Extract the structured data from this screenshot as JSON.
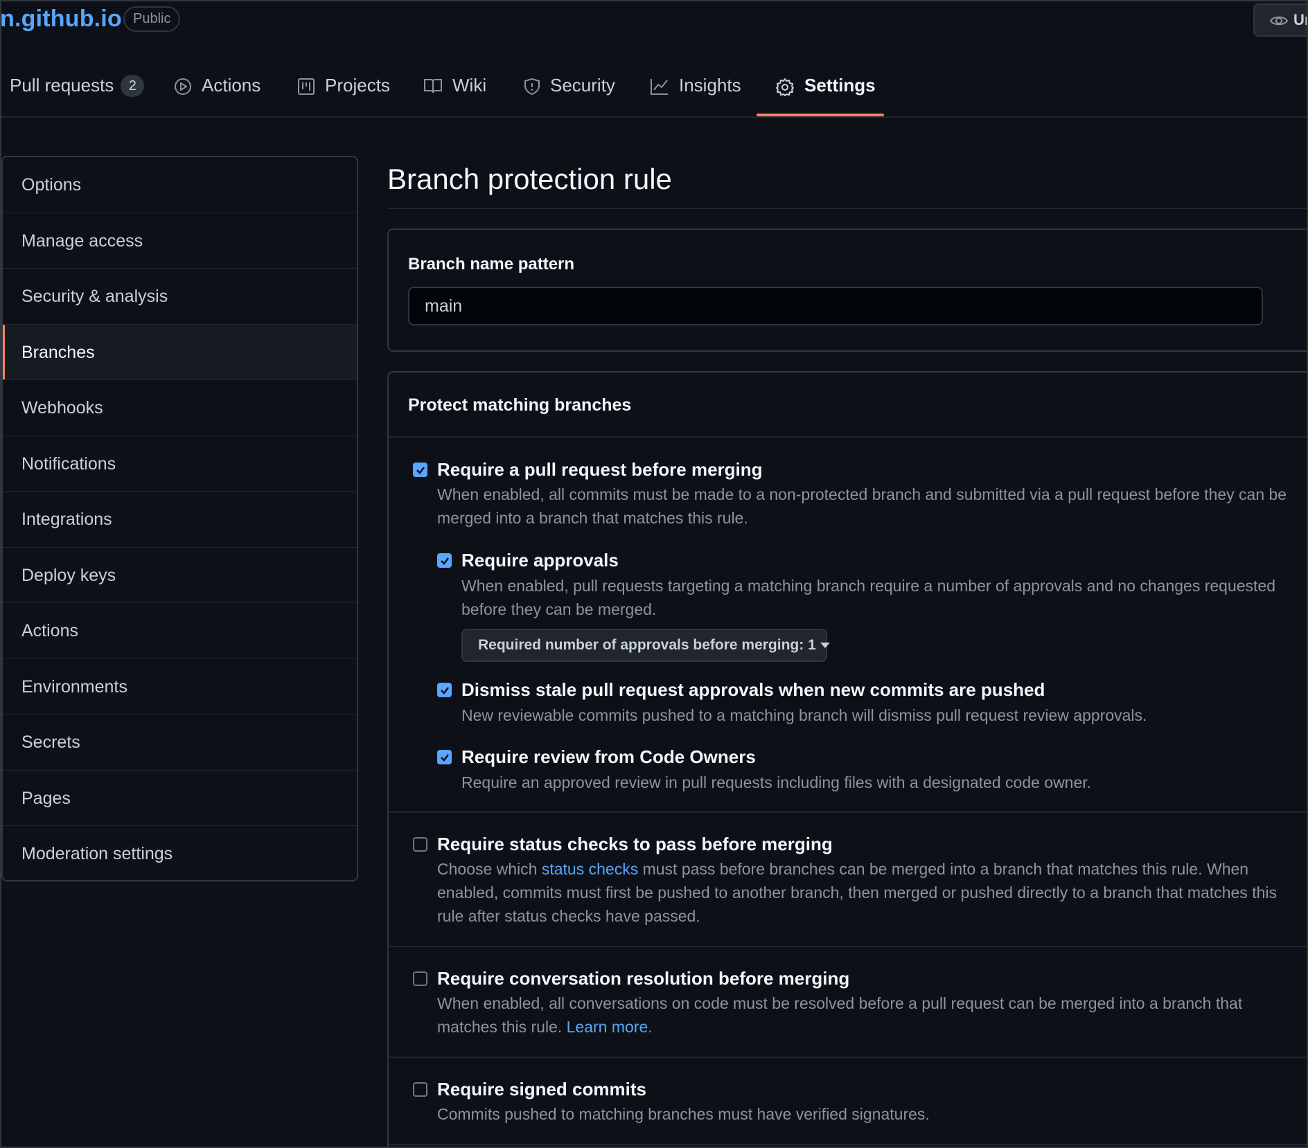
{
  "repo": {
    "name": "n.github.io",
    "visibility": "Public"
  },
  "watch_button": {
    "label": "Un"
  },
  "tabs": [
    {
      "label": "Pull requests",
      "count": "2",
      "icon": "pull-request-icon"
    },
    {
      "label": "Actions",
      "icon": "play-icon"
    },
    {
      "label": "Projects",
      "icon": "project-icon"
    },
    {
      "label": "Wiki",
      "icon": "book-icon"
    },
    {
      "label": "Security",
      "icon": "shield-icon"
    },
    {
      "label": "Insights",
      "icon": "graph-icon"
    },
    {
      "label": "Settings",
      "icon": "gear-icon",
      "active": true
    }
  ],
  "sidebar": {
    "items": [
      "Options",
      "Manage access",
      "Security & analysis",
      "Branches",
      "Webhooks",
      "Notifications",
      "Integrations",
      "Deploy keys",
      "Actions",
      "Environments",
      "Secrets",
      "Pages",
      "Moderation settings"
    ],
    "active": "Branches"
  },
  "main": {
    "title": "Branch protection rule",
    "pattern": {
      "label": "Branch name pattern",
      "value": "main"
    },
    "protect": {
      "heading": "Protect matching branches",
      "require_pr": {
        "title": "Require a pull request before merging",
        "desc": "When enabled, all commits must be made to a non-protected branch and submitted via a pull request before they can be merged into a branch that matches this rule.",
        "checked": true
      },
      "require_approvals": {
        "title": "Require approvals",
        "desc": "When enabled, pull requests targeting a matching branch require a number of approvals and no changes requested before they can be merged.",
        "checked": true,
        "select_label": "Required number of approvals before merging: 1"
      },
      "dismiss_stale": {
        "title": "Dismiss stale pull request approvals when new commits are pushed",
        "desc": "New reviewable commits pushed to a matching branch will dismiss pull request review approvals.",
        "checked": true
      },
      "code_owners": {
        "title": "Require review from Code Owners",
        "desc": "Require an approved review in pull requests including files with a designated code owner.",
        "checked": true
      },
      "status_checks": {
        "title": "Require status checks to pass before merging",
        "desc_pre": "Choose which ",
        "desc_link": "status checks",
        "desc_post": " must pass before branches can be merged into a branch that matches this rule. When enabled, commits must first be pushed to another branch, then merged or pushed directly to a branch that matches this rule after status checks have passed.",
        "checked": false
      },
      "conversation": {
        "title": "Require conversation resolution before merging",
        "desc_pre": "When enabled, all conversations on code must be resolved before a pull request can be merged into a branch that matches this rule. ",
        "desc_link": "Learn more",
        "desc_post": ".",
        "checked": false
      },
      "signed": {
        "title": "Require signed commits",
        "desc": "Commits pushed to matching branches must have verified signatures.",
        "checked": false
      }
    }
  },
  "colors": {
    "accent": "#58a6ff",
    "tab_underline": "#f78166",
    "bg": "#0d1117"
  }
}
